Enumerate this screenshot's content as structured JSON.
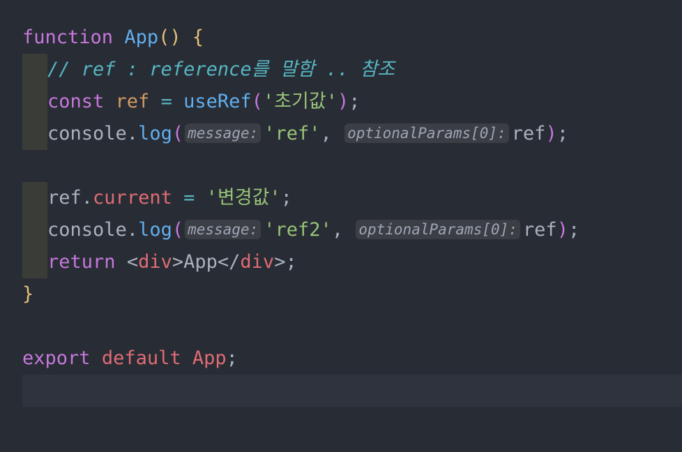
{
  "code": {
    "l1": {
      "kw": "function",
      "name": "App",
      "parens": "()",
      "brace": "{"
    },
    "l2": {
      "comment": "// ref : reference를 말함 .. 참조"
    },
    "l3": {
      "kw": "const",
      "var": "ref",
      "op": "=",
      "fn": "useRef",
      "open": "(",
      "str": "'초기값'",
      "close": ")",
      "semi": ";"
    },
    "l4": {
      "obj": "console",
      "dot": ".",
      "fn": "log",
      "open": "(",
      "hint1": "message:",
      "str": "'ref'",
      "comma": ",",
      "hint2": "optionalParams[0]:",
      "arg": "ref",
      "close": ")",
      "semi": ";"
    },
    "l6": {
      "obj": "ref",
      "dot": ".",
      "prop": "current",
      "op": "=",
      "str": "'변경값'",
      "semi": ";"
    },
    "l7": {
      "obj": "console",
      "dot": ".",
      "fn": "log",
      "open": "(",
      "hint1": "message:",
      "str": "'ref2'",
      "comma": ",",
      "hint2": "optionalParams[0]:",
      "arg": "ref",
      "close": ")",
      "semi": ";"
    },
    "l8": {
      "kw": "return",
      "lt": "<",
      "tag_open": "div",
      "gt": ">",
      "text": "App",
      "lt_close": "</",
      "tag_close": "div",
      "gt2": ">",
      "semi": ";"
    },
    "l9": {
      "brace": "}"
    },
    "l11": {
      "kw": "export",
      "kw2": "default",
      "name": "App",
      "semi": ";"
    }
  },
  "colors": {
    "background": "#282c34",
    "keyword": "#c678dd",
    "function": "#61afef",
    "string": "#98c379",
    "comment": "#56b6c2",
    "variable": "#d19a66",
    "property": "#e06c75",
    "bracket": "#e5c07b"
  }
}
